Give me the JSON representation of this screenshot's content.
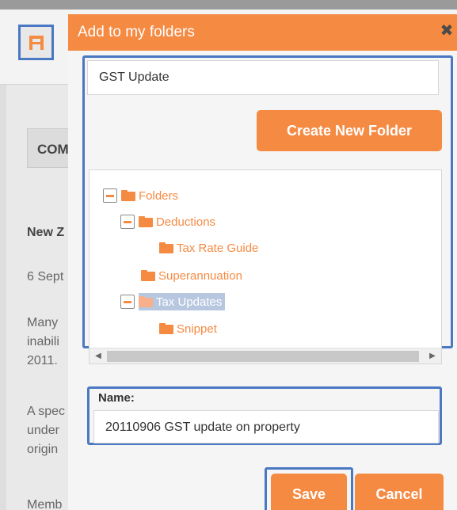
{
  "background": {
    "section_label": "COM",
    "lines": [
      "New Z",
      "6 Sept",
      "Many",
      "inabili",
      "2011.",
      "A spec",
      "under",
      "origin",
      "Memb"
    ]
  },
  "modal": {
    "title": "Add to my folders",
    "close_glyph": "✖",
    "folder_input_value": "GST Update",
    "create_folder_label": "Create New Folder",
    "tree": [
      {
        "label": "Folders",
        "level": 0,
        "expanded": true
      },
      {
        "label": "Deductions",
        "level": 1,
        "expanded": true
      },
      {
        "label": "Tax Rate Guide",
        "level": 2,
        "expanded": false
      },
      {
        "label": "Superannuation",
        "level": 1,
        "expanded": false
      },
      {
        "label": "Tax Updates",
        "level": 1,
        "expanded": true,
        "selected": true
      },
      {
        "label": "Snippet",
        "level": 2,
        "expanded": false
      }
    ],
    "name_label": "Name:",
    "name_value": "20110906 GST update on property",
    "save_label": "Save",
    "cancel_label": "Cancel"
  },
  "colors": {
    "accent": "#f58a42",
    "highlight": "#4a78c2",
    "selection": "#b7c7e0"
  }
}
